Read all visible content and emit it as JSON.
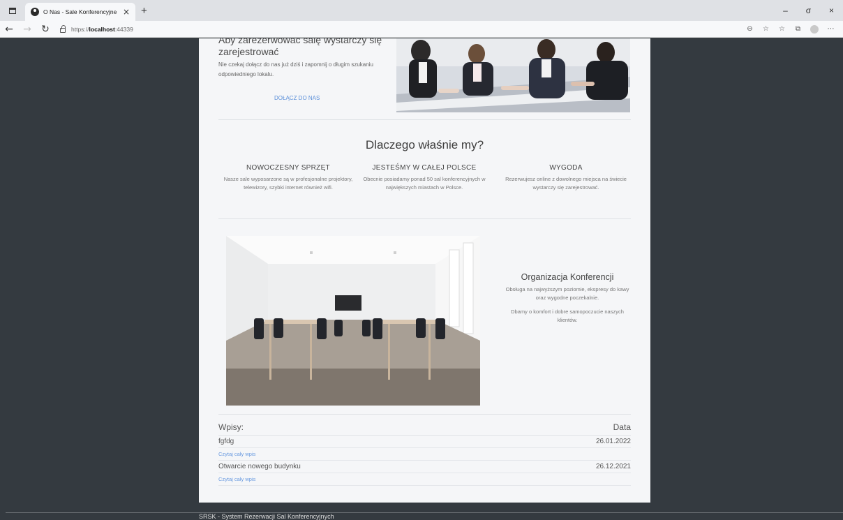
{
  "browser": {
    "tab_title": "O Nas - Sale Konferencyjne",
    "tab_close": "×",
    "new_tab": "+",
    "url_prefix": "https://",
    "url_host": "localhost",
    "url_port": ":44339",
    "win_minimize": "–",
    "win_restore": "σ",
    "win_close": "×"
  },
  "join": {
    "heading": "Aby zarezerwować salę wystarczy się zarejestrować",
    "text": "Nie czekaj dołącz do nas już dziś i zapomnij o długim szukaniu odpowiedniego lokalu.",
    "link": "DOŁĄCZ DO NAS"
  },
  "why": {
    "title": "Dlaczego właśnie my?",
    "features": [
      {
        "title": "NOWOCZESNY SPRZĘT",
        "text": "Nasze sale wyposarzone są w profesjonalne projektory, telewizory, szybki internet również wifi."
      },
      {
        "title": "JESTEŚMY W CAŁEJ POLSCE",
        "text": "Obecnie posiadamy ponad 50 sal konferencyjnych w największych miastach w Polsce."
      },
      {
        "title": "WYGODA",
        "text": "Rezerwujesz online z dowolnego miejsca na świecie wystarczy się zarejestrować."
      }
    ]
  },
  "conference": {
    "title": "Organizacja Konferencji",
    "text1": "Obsługa na najwyższym poziomie, ekspresy do kawy oraz wygodne poczekalnie.",
    "text2": "Dbamy o komfort i dobre samopoczucie naszych klientów."
  },
  "entries": {
    "header_left": "Wpisy:",
    "header_right": "Data",
    "items": [
      {
        "title": "fgfdg",
        "date": "26.01.2022",
        "link": "Czytaj cały wpis"
      },
      {
        "title": "Otwarcie nowego budynku",
        "date": "26.12.2021",
        "link": "Czytaj cały wpis"
      }
    ]
  },
  "footer": {
    "text": "SRSK - System Rezerwacji Sal Konferencyjnych"
  }
}
